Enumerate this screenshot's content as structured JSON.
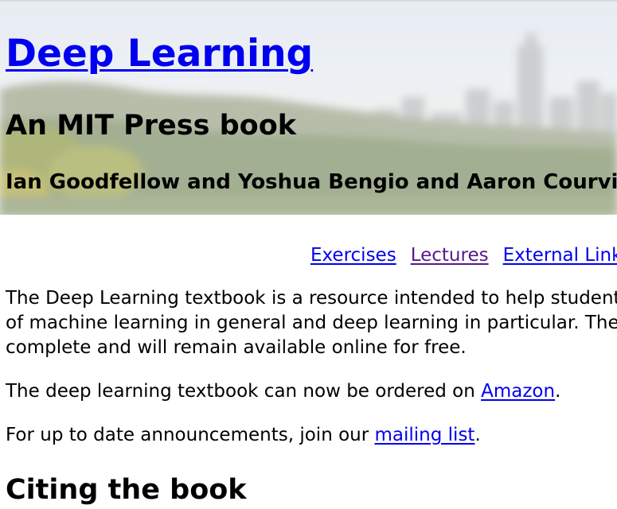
{
  "header": {
    "title": "Deep Learning",
    "subtitle": "An MIT Press book",
    "authors": "Ian Goodfellow and Yoshua Bengio and Aaron Courvill"
  },
  "nav": {
    "items": [
      {
        "label": "Exercises",
        "visited": false
      },
      {
        "label": "Lectures",
        "visited": true
      },
      {
        "label": "External Link",
        "visited": false
      }
    ]
  },
  "content": {
    "intro_line1": "The Deep Learning textbook is a resource intended to help student",
    "intro_line2": "of machine learning in general and deep learning in particular. The",
    "intro_line3": "complete and will remain available online for free.",
    "order_prefix": "The deep learning textbook can now be ordered on ",
    "order_link": "Amazon",
    "order_suffix": ".",
    "announce_prefix": "For up to date announcements, join our ",
    "announce_link": "mailing list",
    "announce_suffix": ".",
    "section_heading": "Citing the book"
  },
  "colors": {
    "link": "#0000ee",
    "visited_link": "#551a8b",
    "text": "#000000"
  }
}
